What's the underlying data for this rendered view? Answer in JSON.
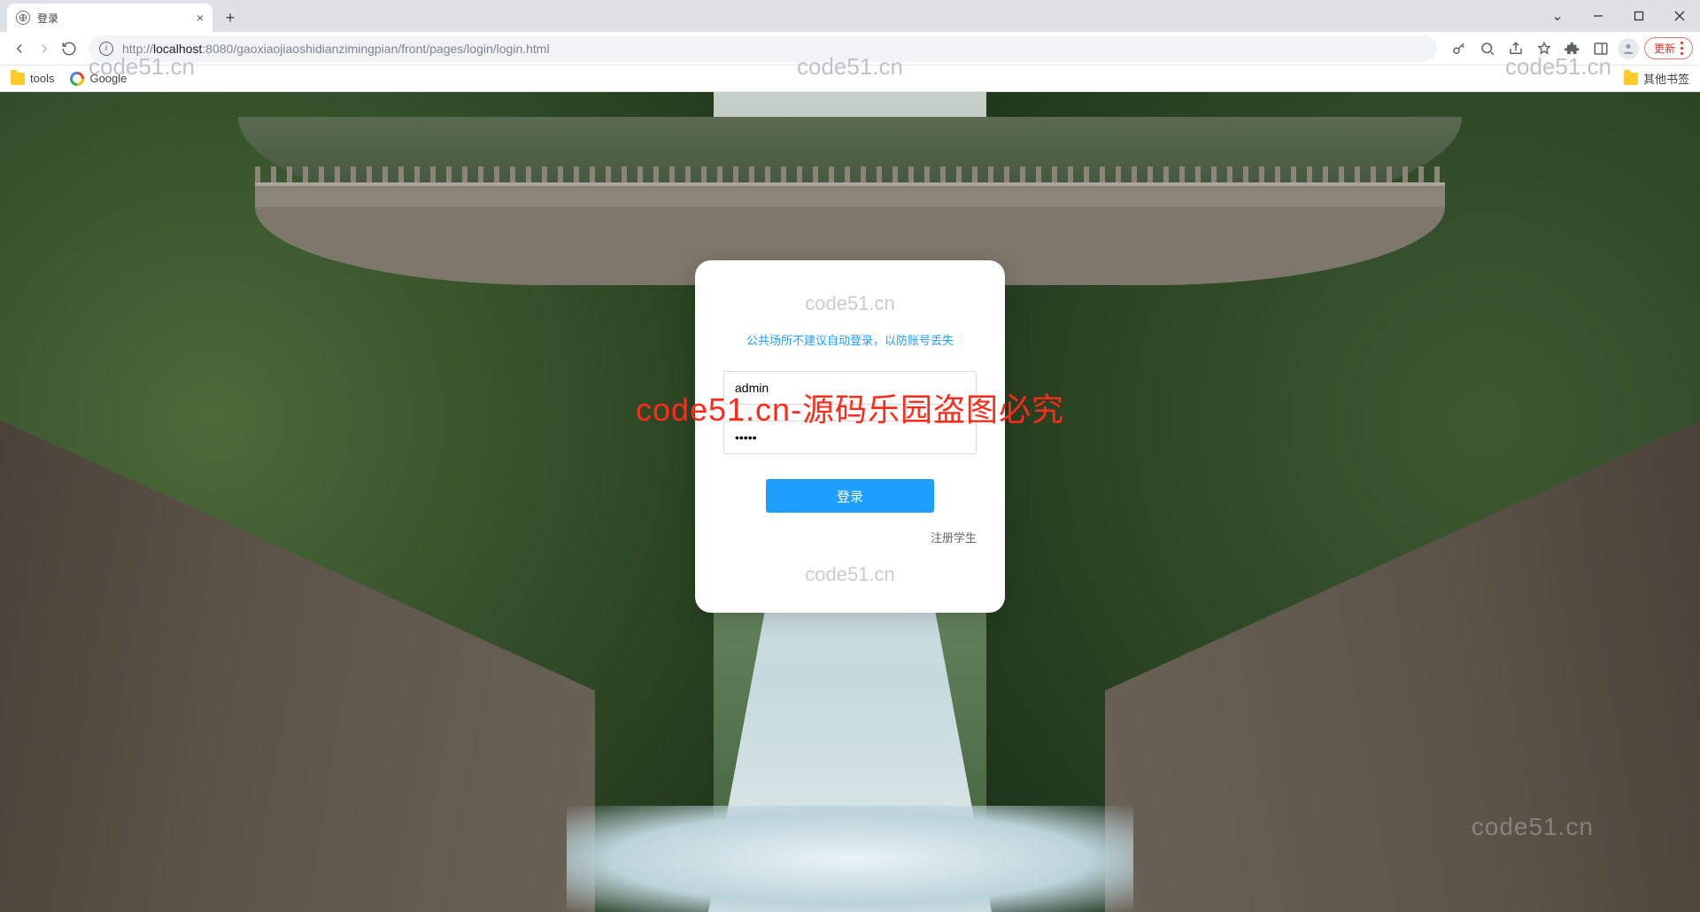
{
  "browser": {
    "tab_title": "登录",
    "url_prefix": "http://",
    "url_host": "localhost",
    "url_port": ":8080",
    "url_path": "/gaoxiaojiaoshidianzimingpian/front/pages/login/login.html",
    "update_label": "更新",
    "bookmarks": {
      "tools": "tools",
      "google": "Google",
      "other": "其他书签"
    }
  },
  "watermarks": {
    "site": "code51.cn",
    "overlay": "code51.cn-源码乐园盗图必究"
  },
  "login": {
    "notice": "公共场所不建议自动登录，以防账号丢失",
    "username_value": "admin",
    "password_value": "•••••",
    "login_button": "登录",
    "register_link": "注册学生"
  }
}
